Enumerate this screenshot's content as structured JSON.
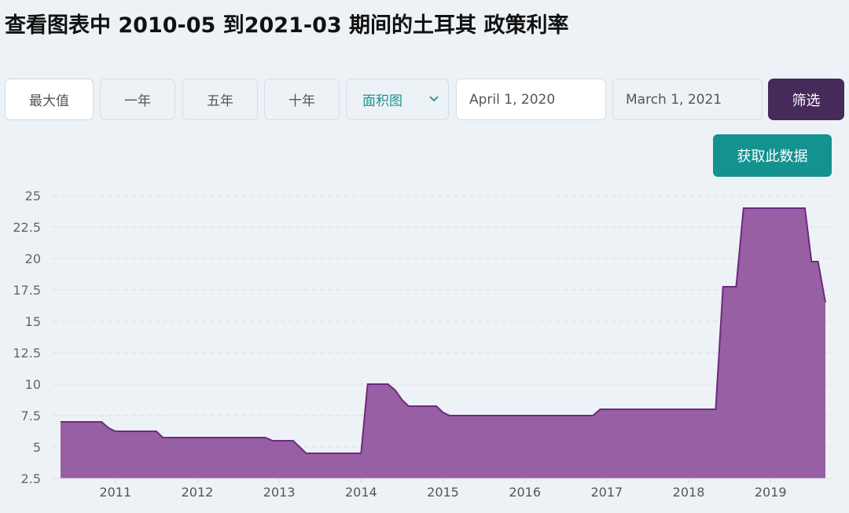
{
  "page_title": "查看图表中 2010-05 到2021-03 期间的土耳其 政策利率",
  "controls": {
    "range_buttons": [
      "最大值",
      "一年",
      "五年",
      "十年"
    ],
    "chart_type_selected": "面积图",
    "start_date": "April 1, 2020",
    "end_date": "March 1, 2021",
    "filter_label": "筛选",
    "get_data_label": "获取此数据"
  },
  "colors": {
    "area_fill": "#8b4a98",
    "area_stroke": "#6e2a7e",
    "filter_button": "#452a5a",
    "get_data_button": "#14928f",
    "select_text": "#1d9393"
  },
  "chart_data": {
    "type": "area",
    "title": "",
    "xlabel": "",
    "ylabel": "",
    "ylim": [
      2.5,
      25
    ],
    "xlim": [
      2010.33,
      2019.67
    ],
    "y_ticks": [
      2.5,
      5,
      7.5,
      10,
      12.5,
      15,
      17.5,
      20,
      22.5,
      25
    ],
    "y_tick_labels": [
      "2.5",
      "5",
      "7.5",
      "10",
      "12.5",
      "15",
      "17.5",
      "20",
      "22.5",
      "25"
    ],
    "x_ticks": [
      2011,
      2012,
      2013,
      2014,
      2015,
      2016,
      2017,
      2018,
      2019
    ],
    "x_tick_labels": [
      "2011",
      "2012",
      "2013",
      "2014",
      "2015",
      "2016",
      "2017",
      "2018",
      "2019"
    ],
    "grid": "horizontal dashed",
    "series": [
      {
        "points": [
          [
            2010.33,
            7.0
          ],
          [
            2010.83,
            7.0
          ],
          [
            2010.92,
            6.5
          ],
          [
            2011.0,
            6.25
          ],
          [
            2011.5,
            6.25
          ],
          [
            2011.58,
            5.75
          ],
          [
            2012.83,
            5.75
          ],
          [
            2012.92,
            5.5
          ],
          [
            2013.17,
            5.5
          ],
          [
            2013.33,
            4.5
          ],
          [
            2014.0,
            4.5
          ],
          [
            2014.08,
            10.0
          ],
          [
            2014.33,
            10.0
          ],
          [
            2014.42,
            9.5
          ],
          [
            2014.5,
            8.75
          ],
          [
            2014.58,
            8.25
          ],
          [
            2014.92,
            8.25
          ],
          [
            2015.0,
            7.75
          ],
          [
            2015.08,
            7.5
          ],
          [
            2016.83,
            7.5
          ],
          [
            2016.92,
            8.0
          ],
          [
            2018.33,
            8.0
          ],
          [
            2018.42,
            17.75
          ],
          [
            2018.58,
            17.75
          ],
          [
            2018.67,
            24.0
          ],
          [
            2019.42,
            24.0
          ],
          [
            2019.5,
            19.75
          ],
          [
            2019.58,
            19.75
          ],
          [
            2019.67,
            16.5
          ]
        ]
      }
    ]
  }
}
